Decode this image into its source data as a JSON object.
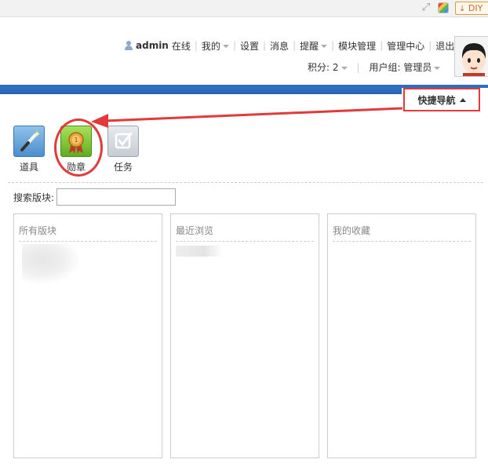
{
  "topbar": {
    "diy_label": "DIY",
    "icons": [
      "expand-icon",
      "color-palette-icon",
      "download-arrow-icon"
    ]
  },
  "user": {
    "name": "admin",
    "status": "在线",
    "menu": [
      "我的",
      "设置",
      "消息",
      "提醒",
      "模块管理",
      "管理中心",
      "退出"
    ],
    "credits_label": "积分: 2",
    "group_label": "用户组: 管理员"
  },
  "quicknav": {
    "label": "快捷导航"
  },
  "shortcuts": [
    {
      "label": "道具",
      "icon": "magic-wand-icon"
    },
    {
      "label": "勋章",
      "icon": "medal-icon"
    },
    {
      "label": "任务",
      "icon": "task-check-icon"
    }
  ],
  "search": {
    "label": "搜索版块:",
    "value": ""
  },
  "columns": [
    {
      "title": "所有版块"
    },
    {
      "title": "最近浏览"
    },
    {
      "title": "我的收藏"
    }
  ],
  "colors": {
    "accent_blue": "#2e6fbf",
    "annotation_red": "#e23a3a",
    "medal_green": "#5fae1f"
  }
}
